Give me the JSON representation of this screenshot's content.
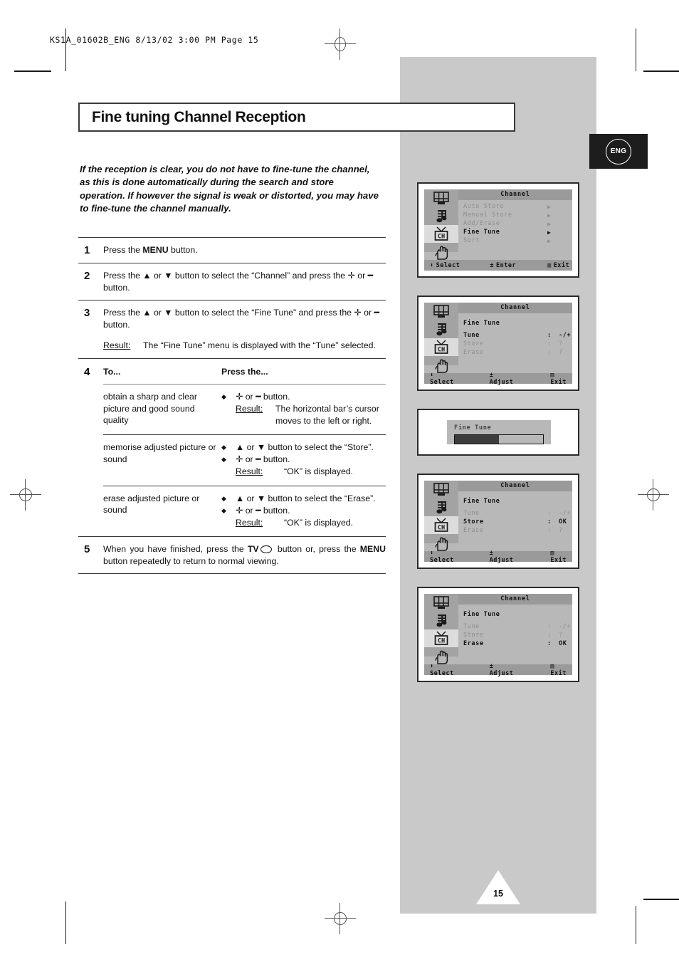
{
  "print": {
    "slug": "KS1A_01602B_ENG   8/13/02   3:00 PM   Page 15",
    "page_number": "15"
  },
  "badge": {
    "language": "ENG"
  },
  "page": {
    "title": "Fine tuning Channel Reception",
    "intro": "If the reception is clear, you do not have to fine-tune the channel, as this is done automatically during the search and store operation. If however the signal is weak or distorted, you may have to fine-tune the channel manually."
  },
  "steps": [
    {
      "num": "1",
      "text_a": "Press the ",
      "bold_a": "MENU",
      "text_b": " button."
    },
    {
      "num": "2",
      "text_a": "Press the ▲ or ▼ button to select the “Channel” and press the ✛ or ━ button."
    },
    {
      "num": "3",
      "text_a": "Press the ▲ or ▼ button to select the “Fine Tune” and press the ✛ or ━ button.",
      "result_label": "Result:",
      "result_text": "The “Fine Tune” menu is displayed with the “Tune” selected."
    }
  ],
  "step4": {
    "num": "4",
    "header": {
      "col1": "To...",
      "col2": "Press the..."
    },
    "rows": [
      {
        "to": "obtain a sharp and clear picture and good sound quality",
        "bullets": [
          "✛ or ━ button."
        ],
        "result_label": "Result:",
        "result_text": "The horizontal bar’s cursor moves to the left or right."
      },
      {
        "to": "memorise adjusted picture or sound",
        "bullets": [
          "▲ or ▼ button to select the “Store”.",
          "✛ or ━ button."
        ],
        "result_label": "Result:",
        "result_text": "“OK” is displayed."
      },
      {
        "to": "erase adjusted picture or sound",
        "bullets": [
          "▲ or ▼ button to select the “Erase”.",
          "✛ or ━ button."
        ],
        "result_label": "Result:",
        "result_text": "“OK” is displayed."
      }
    ]
  },
  "step5": {
    "num": "5",
    "text_a": "When you have finished, press the ",
    "bold_tv": "TV",
    "text_b": " button or, press the ",
    "bold_menu": "MENU",
    "text_c": " button repeatedly to return to normal viewing."
  },
  "osd": {
    "icons": [
      "picture-icon",
      "sound-icon",
      "channel-icon",
      "setup-icon"
    ],
    "channel_icon_label": "CH",
    "panels": [
      {
        "name": "channel-menu",
        "title": "Channel",
        "items": [
          {
            "label": "Auto Store",
            "value": "",
            "arrow": "▶",
            "active": false
          },
          {
            "label": "Manual Store",
            "value": "",
            "arrow": "▶",
            "active": false
          },
          {
            "label": "Add/Erase",
            "value": "",
            "arrow": "▶",
            "active": false
          },
          {
            "label": "Fine Tune",
            "value": "",
            "arrow": "▶",
            "active": true
          },
          {
            "label": "Sort",
            "value": "",
            "arrow": "▶",
            "active": false
          }
        ],
        "footer": {
          "select": "Select",
          "middle": "Enter",
          "exit": "Exit"
        }
      },
      {
        "name": "fine-tune-tune",
        "title": "Channel",
        "heading": "Fine Tune",
        "items": [
          {
            "label": "Tune",
            "colon": ":",
            "value": "-/+",
            "active": true
          },
          {
            "label": "Store",
            "colon": ":",
            "value": "?",
            "active": false
          },
          {
            "label": "Erase",
            "colon": ":",
            "value": "?",
            "active": false
          }
        ],
        "footer": {
          "select": "Select",
          "middle": "Adjust",
          "exit": "Exit"
        }
      },
      {
        "name": "fine-tune-bar",
        "bar_title": "Fine Tune",
        "bar_fill_percent": 50
      },
      {
        "name": "fine-tune-store",
        "title": "Channel",
        "heading": "Fine Tune",
        "items": [
          {
            "label": "Tune",
            "colon": ":",
            "value": "-/+",
            "active": false
          },
          {
            "label": "Store",
            "colon": ":",
            "value": "OK",
            "active": true
          },
          {
            "label": "Erase",
            "colon": ":",
            "value": "?",
            "active": false
          }
        ],
        "footer": {
          "select": "Select",
          "middle": "Adjust",
          "exit": "Exit"
        }
      },
      {
        "name": "fine-tune-erase",
        "title": "Channel",
        "heading": "Fine Tune",
        "items": [
          {
            "label": "Tune",
            "colon": ":",
            "value": "-/+",
            "active": false
          },
          {
            "label": "Store",
            "colon": ":",
            "value": "?",
            "active": false
          },
          {
            "label": "Erase",
            "colon": ":",
            "value": "OK",
            "active": true
          }
        ],
        "footer": {
          "select": "Select",
          "middle": "Adjust",
          "exit": "Exit"
        }
      }
    ]
  }
}
